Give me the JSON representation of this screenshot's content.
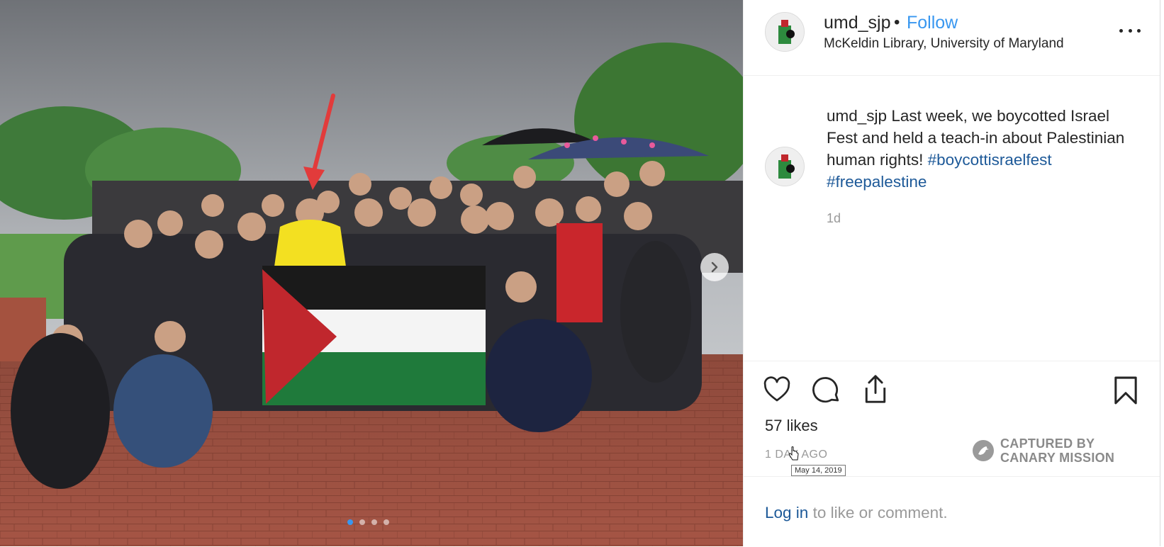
{
  "post": {
    "username": "umd_sjp",
    "separator": "•",
    "follow_label": "Follow",
    "location": "McKeldin Library, University of Maryland",
    "caption_text": "Last week, we boycotted Israel Fest and held a teach-in about Palestinian human rights!",
    "hashtags": [
      "#boycottisraelfest",
      "#freepalestine"
    ],
    "comment_time": "1d",
    "likes": "57 likes",
    "posted_ago": "1 DAY AGO",
    "date_tooltip": "May 14, 2019",
    "watermark_line1": "CAPTURED BY",
    "watermark_line2": "CANARY MISSION",
    "login_link": "Log in",
    "login_rest": " to like or comment."
  },
  "carousel": {
    "slides": 4,
    "active_index": 0
  },
  "colors": {
    "link_blue": "#3897f0",
    "hashtag_blue": "#1d5998",
    "muted": "#999999",
    "text": "#262626"
  },
  "icons": [
    "heart-icon",
    "comment-icon",
    "share-icon",
    "bookmark-icon",
    "more-options-icon",
    "chevron-right-icon"
  ]
}
